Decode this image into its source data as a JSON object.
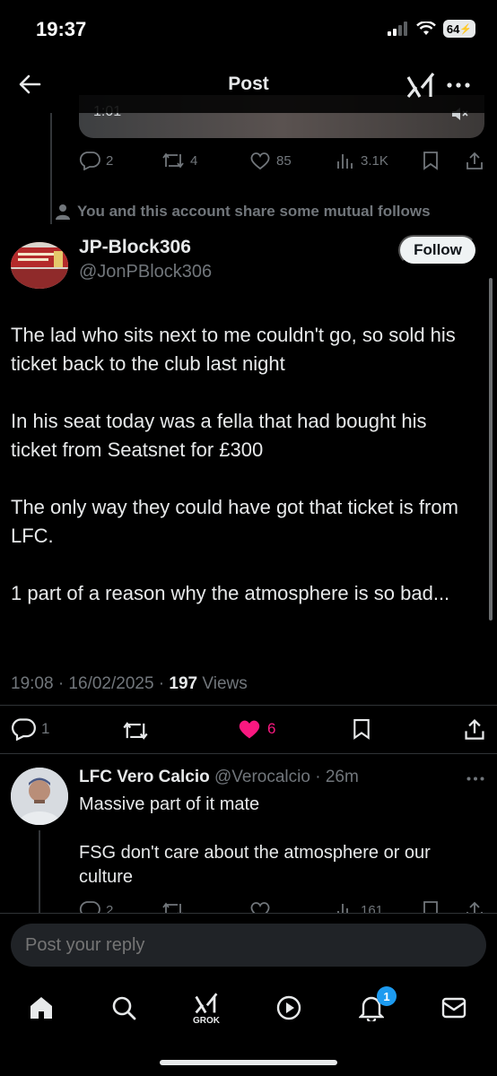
{
  "status_bar": {
    "time": "19:37",
    "battery": "64"
  },
  "header": {
    "title": "Post"
  },
  "previous_post": {
    "video_time": "1:01",
    "replies": "2",
    "reposts": "4",
    "likes": "85",
    "views": "3.1K"
  },
  "mutual_note": "You and this account share some mutual follows",
  "post": {
    "author_name": "JP-Block306",
    "author_handle": "@JonPBlock306",
    "follow_label": "Follow",
    "paragraphs": [
      "The lad who sits next to me couldn't go, so sold his ticket back to the club last night",
      "In his seat today was a fella that had bought his ticket from Seatsnet for £300",
      "The only way they could have got that ticket is from LFC.",
      "1 part of a reason why the atmosphere is so bad..."
    ],
    "timestamp": "19:08 · 16/02/2025 · ",
    "views_count": "197",
    "views_label": " Views",
    "replies": "1",
    "likes": "6",
    "like_color": "#f91880"
  },
  "reply": {
    "author_name": "LFC Vero Calcio",
    "author_handle": " @Verocalcio",
    "time": " · 26m",
    "paragraphs": [
      "Massive part of it mate",
      "FSG don't care about the atmosphere or our culture"
    ],
    "replies": "2",
    "views": "161"
  },
  "composer": {
    "placeholder": "Post your reply"
  },
  "tabbar": {
    "grok_label": "GROK",
    "notification_count": "1"
  },
  "icons": [
    "back-arrow-icon",
    "grok-icon",
    "more-icon",
    "mute-icon",
    "reply-icon",
    "repost-icon",
    "like-icon",
    "views-icon",
    "bookmark-icon",
    "share-icon",
    "person-icon",
    "home-icon",
    "search-icon",
    "play-icon",
    "bell-icon",
    "mail-icon"
  ]
}
